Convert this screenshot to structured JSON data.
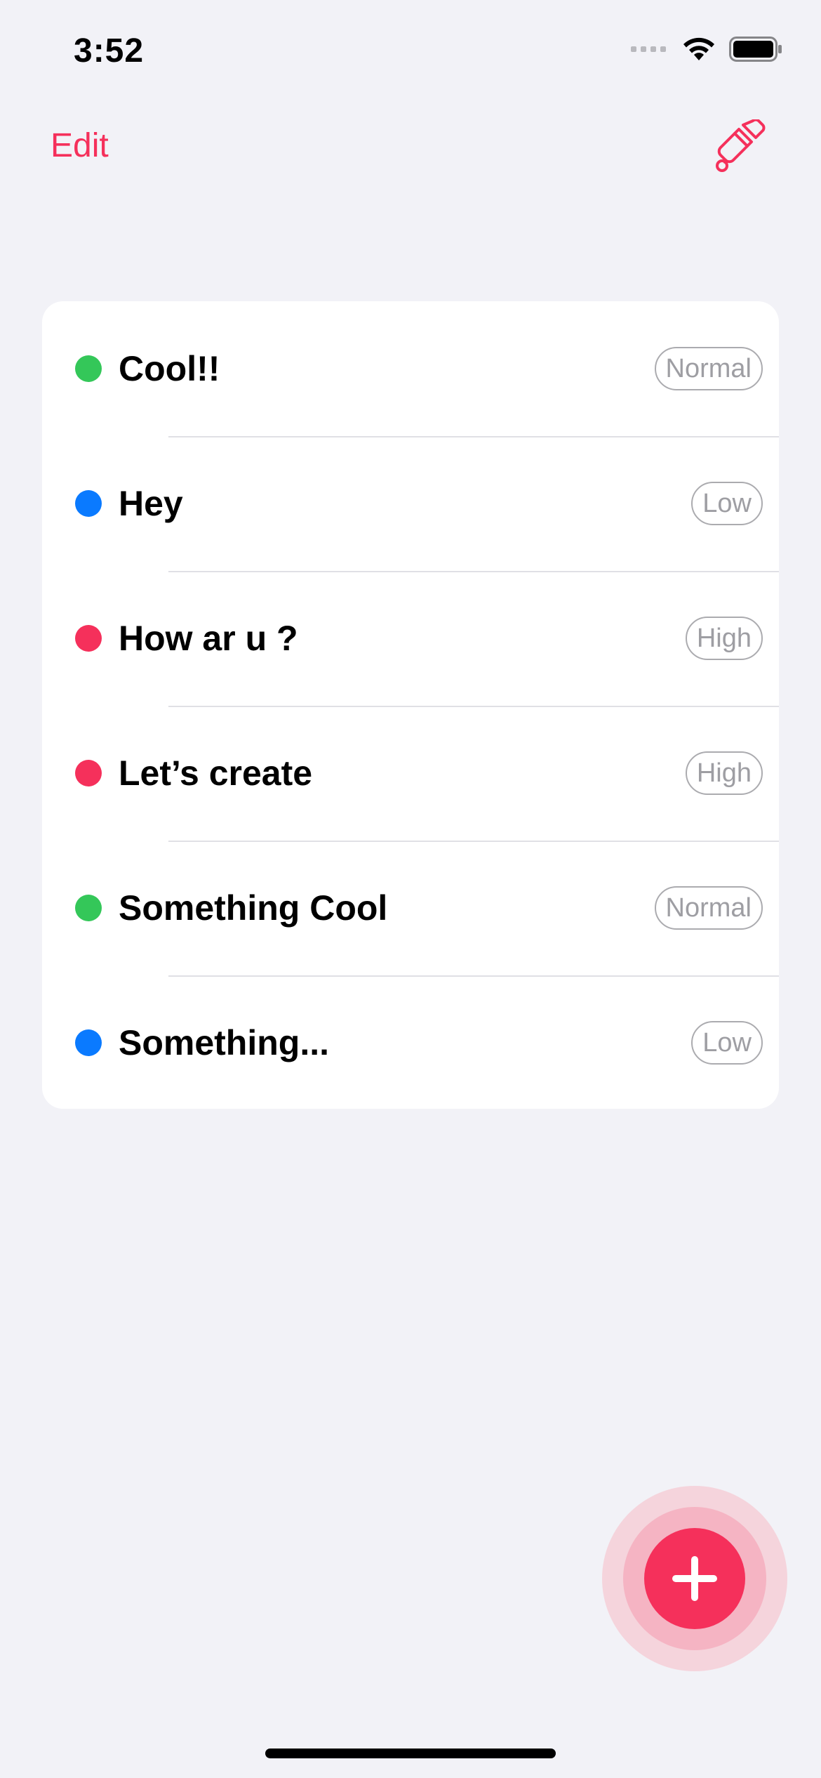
{
  "status_bar": {
    "time": "3:52"
  },
  "nav": {
    "edit_label": "Edit",
    "theme_icon": "paintbrush-icon"
  },
  "colors": {
    "accent": "#F5305B",
    "priority_high": "#F5305B",
    "priority_normal": "#34C759",
    "priority_low": "#0A7AFF",
    "background": "#F2F2F7"
  },
  "tasks": [
    {
      "title": "Cool!!",
      "priority": "Normal"
    },
    {
      "title": "Hey",
      "priority": "Low"
    },
    {
      "title": "How ar u ?",
      "priority": "High"
    },
    {
      "title": "Let’s create",
      "priority": "High"
    },
    {
      "title": "Something Cool",
      "priority": "Normal"
    },
    {
      "title": "Something...",
      "priority": "Low"
    }
  ],
  "fab": {
    "icon": "plus-icon"
  }
}
